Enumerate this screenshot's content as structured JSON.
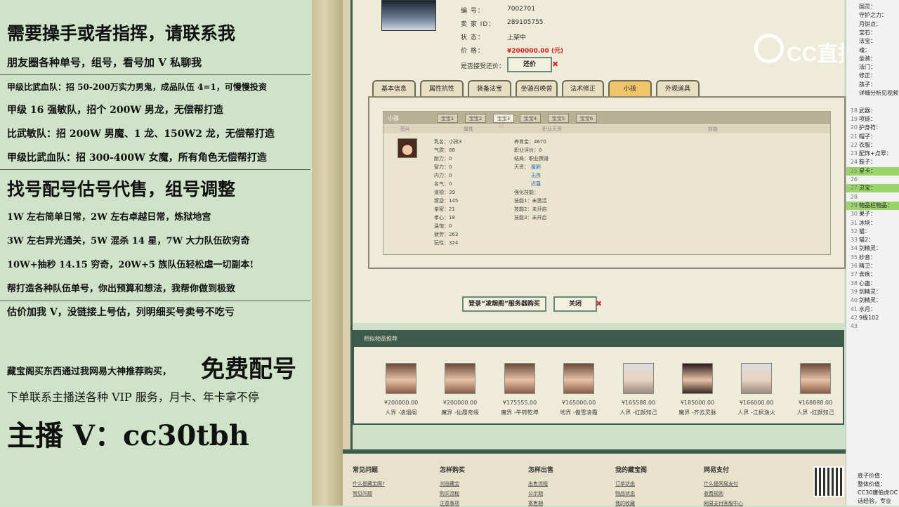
{
  "ad": {
    "lines": [
      "需要操手或者指挥，请联系我",
      "朋友圈各种单号，组号，看号加 V 私聊我",
      "甲级比武血队：招 50-200万实力男鬼，成品队伍 4=1，可慢慢投资",
      "甲级 16 强敏队，招个 200W 男龙，无偿帮打造",
      "比武敏队：招 200W 男魔、1 龙、150W2 龙，无偿帮打造",
      "甲级比武血队：招 300-400W 女魔，所有角色无偿帮打造",
      "找号配号估号代售，组号调整",
      "1W 左右简单日常，2W 左右卓越日常，炼狱地宫",
      "3W 左右异光通关，5W 混杀 14 星，7W 大力队伍砍穷奇",
      "10W+抽秒 14.15 穷奇，20W+5 族队伍轻松虐一切副本!",
      "帮打造各种队伍单号，你出预算和想法，我帮你做到极致",
      "估价加我 V，没链接上号估，列明细买号卖号不吃亏"
    ],
    "promo_small": "藏宝阁买东西通过我网易大神推荐购买，",
    "promo_big": "免费配号",
    "vip": "下单联系主播送各种 VIP 服务，月卡、年卡拿不停",
    "anchor": "主播 V：cc30tbh"
  },
  "info": {
    "labels": [
      "编 号：",
      "卖 家 ID：",
      "状 态：",
      "价 格："
    ],
    "values": [
      "7002701",
      "289105755",
      "上架中",
      "¥200000.00 (元)"
    ],
    "bargain_label": "是否接受还价：",
    "bargain_btn": "还价"
  },
  "tabs": [
    "基本信息",
    "属性抗性",
    "装备法宝",
    "坐骑召唤兽",
    "法术修正",
    "小孩",
    "外观道具"
  ],
  "inner": {
    "title": "小孩",
    "subtabs": [
      "宝宝1",
      "宝宝2",
      "宝宝3",
      "宝宝4",
      "宝宝5",
      "宝宝6"
    ],
    "cols": [
      "图片",
      "属性",
      "职业天资",
      "技能"
    ],
    "stats": [
      "乳名：小孩3",
      "气质：88",
      "耐力：0",
      "智力：0",
      "内力：0",
      "名气：0",
      "道德：39",
      "叛逆：145",
      "亲密：21",
      "孝心：18",
      "温饱：0",
      "疲劳：263",
      "玩性：324"
    ],
    "stats2": [
      "养育金：4670",
      "职业评价：0",
      "结局：职业撰谱",
      "天资：",
      "强化技能：",
      "技能1：未激活",
      "技能2：未开启",
      "技能3：未开启"
    ],
    "talents": [
      "魔胆",
      "无畏",
      "迟蔑"
    ]
  },
  "buy_btn": "登录“凌烟阁”服务器购买",
  "close_btn": "关闭",
  "similar": {
    "title": "相似物品推荐",
    "items": [
      {
        "price": "¥200000.00",
        "name": "人界 -凌烟阁"
      },
      {
        "price": "¥200000.00",
        "name": "魔界 -仙履奇缘"
      },
      {
        "price": "¥175555.00",
        "name": "魔界 -牛转乾坤"
      },
      {
        "price": "¥165000.00",
        "name": "地界 -傲雪凌霜"
      },
      {
        "price": "¥165588.00",
        "name": "人界 -红颜知己"
      },
      {
        "price": "¥185000.00",
        "name": "魔界 -齐云灵脉"
      },
      {
        "price": "¥166000.00",
        "name": "人界 -江枫渔火"
      },
      {
        "price": "¥168888.00",
        "name": "人界 -红颜知己"
      }
    ]
  },
  "footer": {
    "cols": [
      "常见问题",
      "怎样购买",
      "怎样出售",
      "我的藏宝阁",
      "网易支付"
    ],
    "links": [
      [
        "什么是藏宝阁?",
        "常见问题"
      ],
      [
        "浏览藏宝",
        "购买流程",
        "注意事项"
      ],
      [
        "出售流程",
        "公示期",
        "寄售期"
      ],
      [
        "订单状态",
        "物品状态",
        "我的收藏"
      ],
      [
        "什么是网易支付",
        "收费规则",
        "网易支付客服中心"
      ]
    ]
  },
  "watermark": "CC直播",
  "side": {
    "lines": [
      [
        "",
        "国灵："
      ],
      [
        "",
        "守护之力："
      ],
      [
        "",
        "月饼点："
      ],
      [
        "",
        "宝石："
      ],
      [
        "",
        "法宝："
      ],
      [
        "",
        "魂："
      ],
      [
        "",
        "坐骑："
      ],
      [
        "",
        "法门："
      ],
      [
        "",
        "修正："
      ],
      [
        "",
        "孩子："
      ],
      [
        "",
        "详细分析见视频"
      ],
      [
        "",
        ""
      ],
      [
        "18",
        "武器："
      ],
      [
        "19",
        "项链："
      ],
      [
        "20",
        "护身符："
      ],
      [
        "21",
        "帽子："
      ],
      [
        "22",
        "衣服："
      ],
      [
        "23",
        "配饰+点翠："
      ],
      [
        "24",
        "鞋子："
      ],
      [
        "25",
        "星卡："
      ],
      [
        "26",
        ""
      ],
      [
        "27",
        "灵宝："
      ],
      [
        "28",
        ""
      ],
      [
        "29",
        "物品栏物品："
      ],
      [
        "30",
        "果子："
      ],
      [
        "31",
        "冰块："
      ],
      [
        "32",
        "猫："
      ],
      [
        "33",
        "猫2："
      ],
      [
        "34",
        "剑精灵："
      ],
      [
        "35",
        "妙音："
      ],
      [
        "36",
        "精卫："
      ],
      [
        "37",
        "去疾："
      ],
      [
        "38",
        "心蛊："
      ],
      [
        "39",
        "剑精灵："
      ],
      [
        "40",
        "剑精灵："
      ],
      [
        "41",
        "水月："
      ],
      [
        "42",
        "9级102"
      ],
      [
        "43",
        ""
      ]
    ],
    "bottom": [
      "底子价值：",
      "整体价值：",
      "CC30唐伯虎OC",
      "话经验，专业"
    ]
  }
}
